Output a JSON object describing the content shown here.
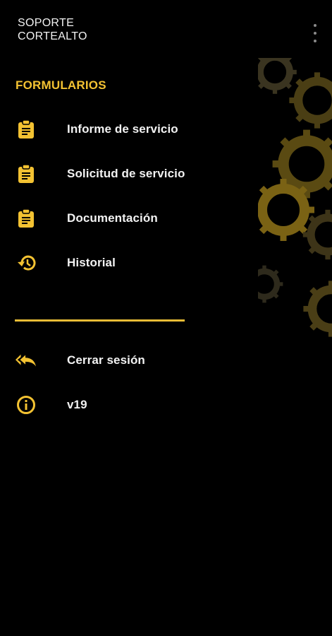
{
  "header": {
    "title_line1": "SOPORTE",
    "title_line2": "CORTEALTO",
    "menu_icon": "more-vert-icon"
  },
  "drawer": {
    "section_title": "FORMULARIOS",
    "items": [
      {
        "label": "Informe de servicio",
        "icon": "clipboard-icon"
      },
      {
        "label": "Solicitud de servicio",
        "icon": "clipboard-icon"
      },
      {
        "label": "Documentación",
        "icon": "clipboard-icon"
      },
      {
        "label": "Historial",
        "icon": "history-icon"
      }
    ],
    "footer_items": [
      {
        "label": "Cerrar sesión",
        "icon": "reply-all-icon"
      },
      {
        "label": "v19",
        "icon": "info-icon"
      }
    ]
  },
  "colors": {
    "accent": "#F3C232",
    "background": "#000000",
    "text": "#F2F2F2"
  }
}
